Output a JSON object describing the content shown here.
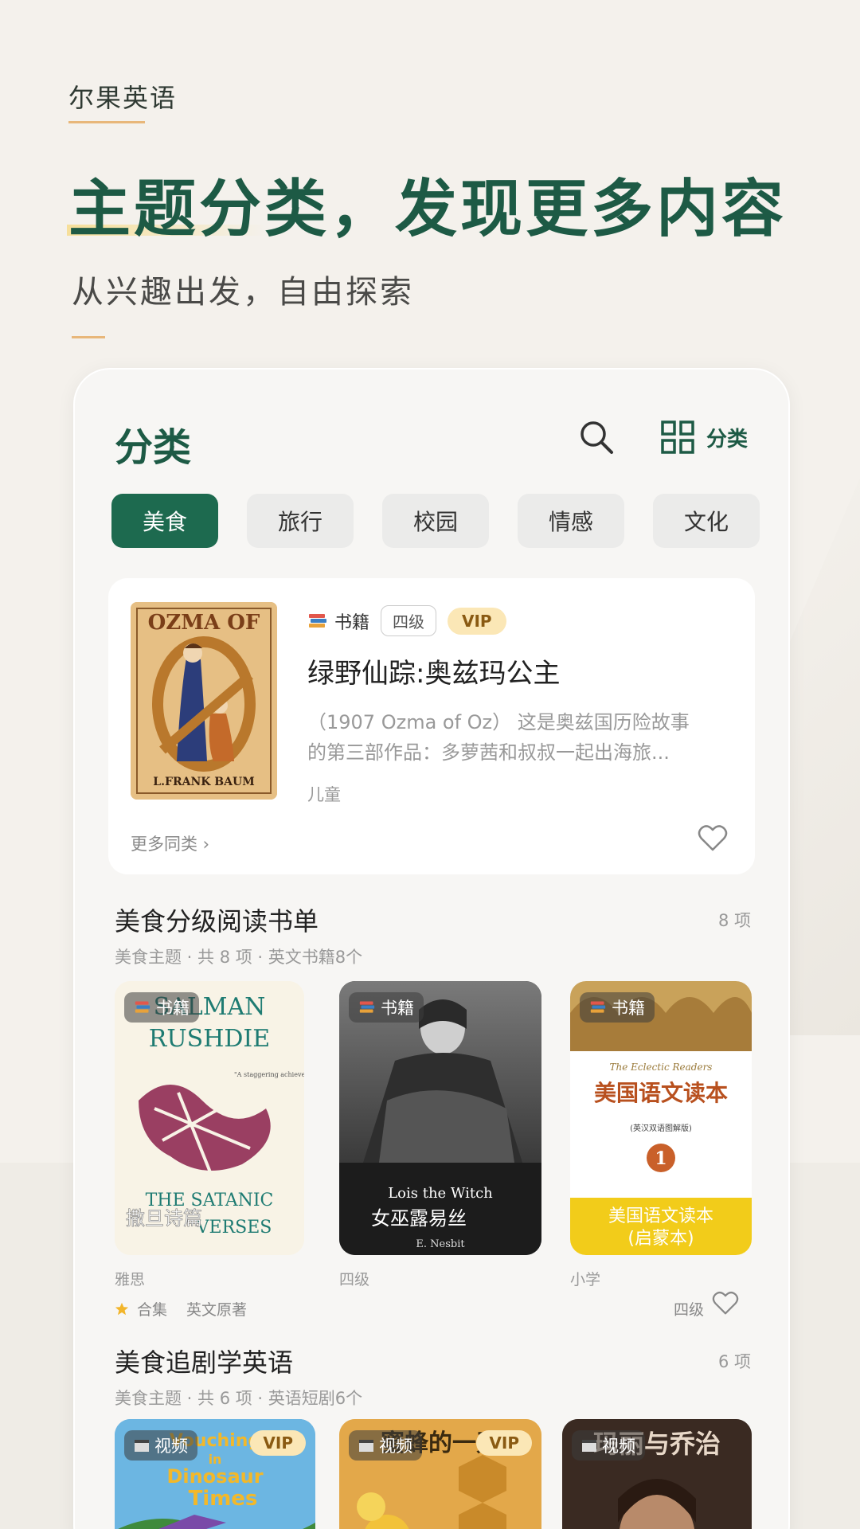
{
  "hero": {
    "brand": "尔果英语",
    "title": "主题分类，发现更多内容",
    "subtitle": "从兴趣出发，自由探索"
  },
  "header": {
    "title": "分类",
    "category_label": "分类"
  },
  "chips": [
    "美食",
    "旅行",
    "校园",
    "情感",
    "文化"
  ],
  "feature": {
    "type_label": "书籍",
    "level": "四级",
    "vip": "VIP",
    "title": "绿野仙踪:奥兹玛公主",
    "desc_line1": "（1907 Ozma of Oz） 这是奥兹国历险故事",
    "desc_line2": "的第三部作品：多萝茜和叔叔一起出海旅...",
    "category": "儿童",
    "more": "更多同类 ›",
    "cover": {
      "title": "OZMA OF",
      "author": "L.FRANK BAUM"
    }
  },
  "section1": {
    "title": "美食分级阅读书单",
    "count": "8 项",
    "subtitle": "美食主题 · 共 8 项 · 英文书籍8个",
    "books": [
      {
        "type": "书籍",
        "level": "雅思",
        "cover_top1": "SALMAN",
        "cover_top2": "RUSHDIE",
        "cover_bottom1": "THE SATANIC",
        "cover_bottom2": "VERSES",
        "cover_cn": "撒旦诗篇",
        "quote": "\"A staggering achievement, extremely impressive.\" —WASHINGTON OBSERVER"
      },
      {
        "type": "书籍",
        "level": "四级",
        "cover_en": "Lois the Witch",
        "cover_cn": "女巫露易丝",
        "cover_author": "E. Nesbit"
      },
      {
        "type": "书籍",
        "level": "小学",
        "cover_series": "The Eclectic Readers",
        "cover_title": "美国语文读本",
        "cover_small": "(英汉双语图解版)",
        "cover_num": "1",
        "cover_banner1": "美国语文读本",
        "cover_banner2": "(启蒙本)"
      }
    ],
    "footer_tag1": "合集",
    "footer_tag2": "英文原著",
    "footer_level": "四级"
  },
  "section2": {
    "title": "美食追剧学英语",
    "count": "6 项",
    "subtitle": "美食主题 · 共 6 项 · 英语短剧6个",
    "videos": [
      {
        "type": "视频",
        "vip": "VIP",
        "cover_text1": "Vouching",
        "cover_text2": "in",
        "cover_text3": "Dinosaur",
        "cover_text4": "Times"
      },
      {
        "type": "视频",
        "vip": "VIP",
        "cover_text": "蜜蜂的一天"
      },
      {
        "type": "视频",
        "cover_text": "玛丽与乔治"
      }
    ]
  },
  "colors": {
    "accent": "#1d5a45",
    "chip_active": "#1d6a4f",
    "vip_bg": "#fbe7b6",
    "gold": "#e8b77a"
  }
}
